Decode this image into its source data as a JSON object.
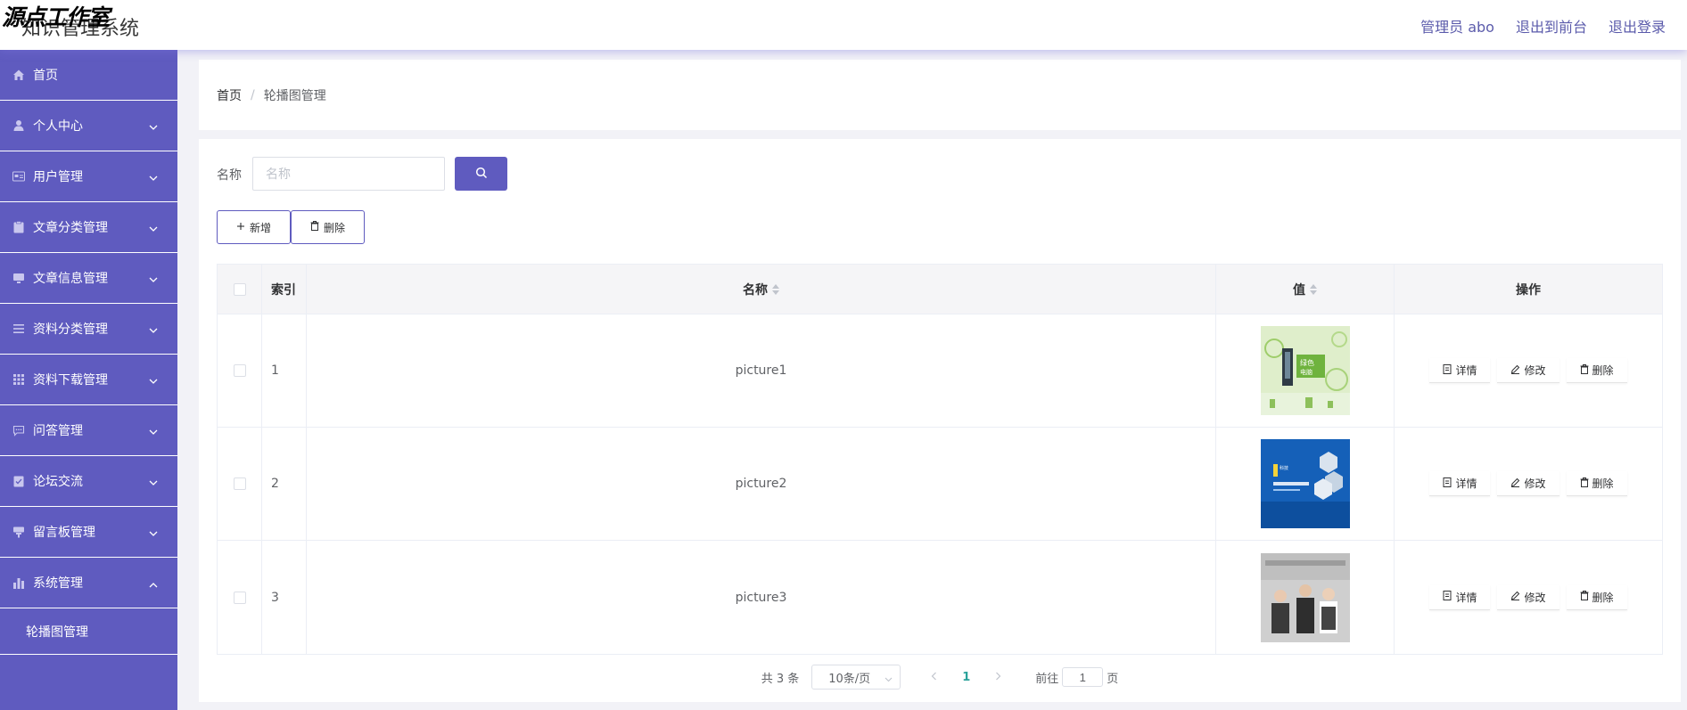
{
  "header": {
    "watermark": "源点工作室",
    "system_title": "知识管理系统",
    "admin_label": "管理员 abo",
    "back_to_front": "退出到前台",
    "logout": "退出登录"
  },
  "sidebar": {
    "items": [
      {
        "label": "首页",
        "icon": "home-icon",
        "expandable": false
      },
      {
        "label": "个人中心",
        "icon": "user-icon",
        "expandable": true
      },
      {
        "label": "用户管理",
        "icon": "id-card-icon",
        "expandable": true
      },
      {
        "label": "文章分类管理",
        "icon": "clipboard-icon",
        "expandable": true
      },
      {
        "label": "文章信息管理",
        "icon": "monitor-icon",
        "expandable": true
      },
      {
        "label": "资料分类管理",
        "icon": "list-icon",
        "expandable": true
      },
      {
        "label": "资料下载管理",
        "icon": "grid-icon",
        "expandable": true
      },
      {
        "label": "问答管理",
        "icon": "chat-icon",
        "expandable": true
      },
      {
        "label": "论坛交流",
        "icon": "checklist-icon",
        "expandable": true
      },
      {
        "label": "留言板管理",
        "icon": "board-icon",
        "expandable": true
      },
      {
        "label": "系统管理",
        "icon": "bar-chart-icon",
        "expandable": true,
        "expanded": true
      }
    ],
    "submenu": {
      "label": "轮播图管理"
    }
  },
  "breadcrumb": {
    "home": "首页",
    "separator": "/",
    "current": "轮播图管理"
  },
  "search": {
    "label": "名称",
    "placeholder": "名称"
  },
  "actions": {
    "add_label": "新增",
    "delete_label": "删除"
  },
  "table": {
    "headers": {
      "index": "索引",
      "name": "名称",
      "value": "值",
      "operation": "操作"
    },
    "rows": [
      {
        "index": "1",
        "name": "picture1",
        "image": "green-computer-banner"
      },
      {
        "index": "2",
        "name": "picture2",
        "image": "blue-tech-banner"
      },
      {
        "index": "3",
        "name": "picture3",
        "image": "business-people-banner"
      }
    ],
    "row_actions": {
      "detail": "详情",
      "edit": "修改",
      "delete": "删除"
    }
  },
  "pagination": {
    "total": "共 3 条",
    "page_size": "10条/页",
    "current_page": "1",
    "goto_label": "前往",
    "goto_value": "1",
    "page_suffix": "页"
  },
  "colors": {
    "primary": "#5f5bbf",
    "accent_page": "#2aa29a"
  }
}
